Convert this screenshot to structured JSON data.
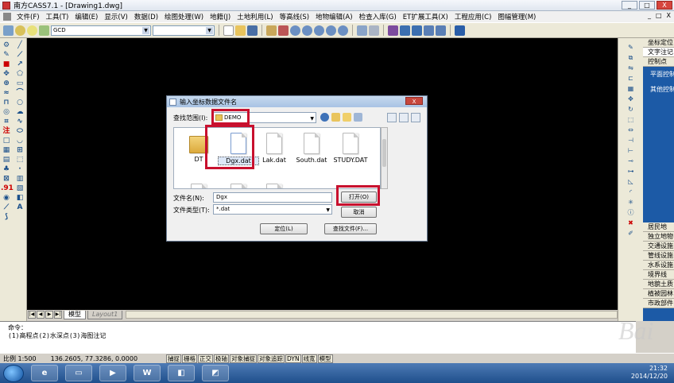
{
  "window": {
    "title": "南方CASS7.1 - [Drawing1.dwg]",
    "controls": [
      "_",
      "□",
      "X"
    ]
  },
  "menubar": {
    "items": [
      "文件(F)",
      "工具(T)",
      "编辑(E)",
      "显示(V)",
      "数据(D)",
      "绘图处理(W)",
      "地籍(J)",
      "土地利用(L)",
      "等高线(S)",
      "地物编辑(A)",
      "检查入库(G)",
      "ET扩展工具(X)",
      "工程应用(C)",
      "图幅管理(M)"
    ],
    "doc_controls": [
      "_",
      "□",
      "X"
    ]
  },
  "toolbar": {
    "layer_value": "GCD"
  },
  "dialog": {
    "title": "输入坐标数据文件名",
    "close": "X",
    "look_in_label": "查找范围(I):",
    "look_in_value": "DEMO",
    "files": [
      {
        "name": "DT",
        "type": "folder"
      },
      {
        "name": "Dgx.dat",
        "type": "file",
        "selected": true
      },
      {
        "name": "Lak.dat",
        "type": "file"
      },
      {
        "name": "South.dat",
        "type": "file"
      },
      {
        "name": "STUDY.DAT",
        "type": "file"
      }
    ],
    "filename_label": "文件名(N):",
    "filename_value": "Dgx",
    "filetype_label": "文件类型(T):",
    "filetype_value": "*.dat",
    "open_button": "打开(O)",
    "cancel_button": "取消",
    "locate_button": "定位(L)",
    "find_button": "查找文件(F)..."
  },
  "tabs": {
    "model": "模型",
    "layout": "Layout1"
  },
  "right_panel": {
    "header_label": "坐标定位",
    "top_items": [
      "文字注记",
      "控制点"
    ],
    "links": [
      "平面控制",
      "其他控制"
    ],
    "items": [
      "居民地",
      "独立地物",
      "交通设施",
      "管线设施",
      "水系设施",
      "境界线",
      "地貌土质",
      "植被园林",
      "市政部件"
    ]
  },
  "command": {
    "line1": "命令：",
    "line2": "(1)高程点(2)水深点(3)海图注记"
  },
  "status": {
    "scale": "比例 1:500",
    "coords": "136.2605, 77.3286, 0.0000",
    "buttons": [
      "捕捉",
      "栅格",
      "正交",
      "极轴",
      "对象捕捉",
      "对象追踪",
      "DYN",
      "线宽",
      "模型"
    ]
  },
  "taskbar": {
    "time": "21:32",
    "date": "2014/12/20"
  },
  "watermark": "Bai",
  "colors": {
    "highlight": "#c8102e",
    "panel_blue": "#1c5aa6",
    "canvas": "#000000"
  }
}
